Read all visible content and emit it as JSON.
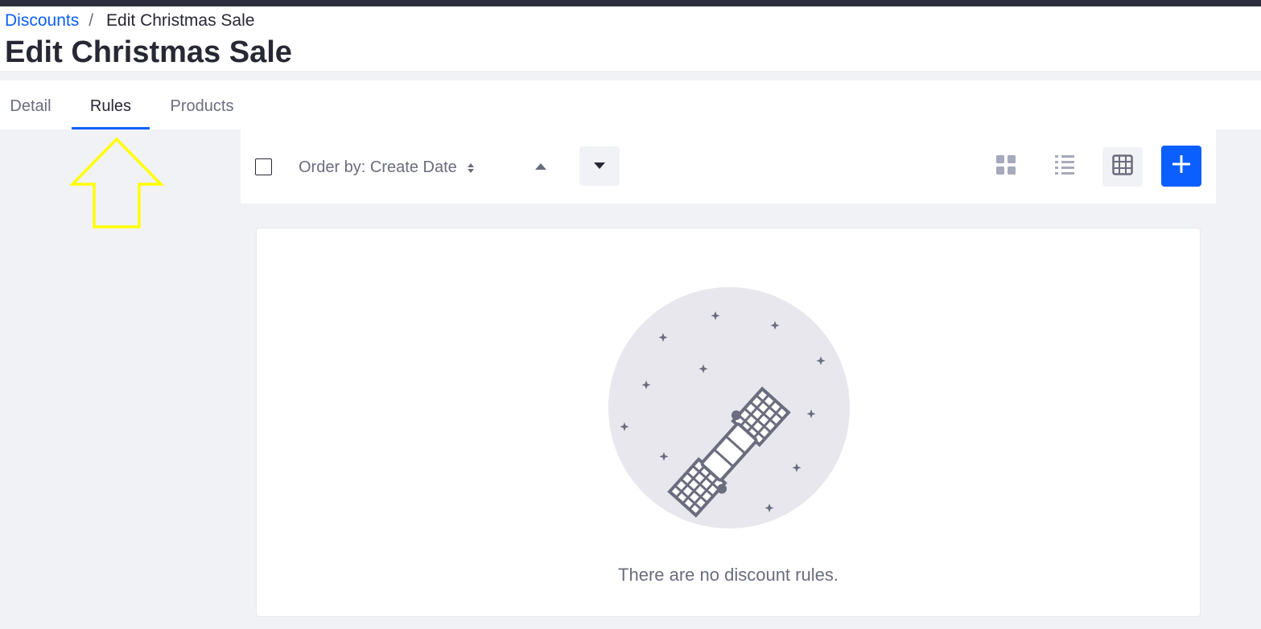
{
  "breadcrumb": {
    "parent": "Discounts",
    "separator": "/",
    "current": "Edit Christmas Sale"
  },
  "page": {
    "title": "Edit Christmas Sale"
  },
  "tabs": [
    {
      "label": "Detail",
      "active": false
    },
    {
      "label": "Rules",
      "active": true
    },
    {
      "label": "Products",
      "active": false
    }
  ],
  "toolbar": {
    "order_by_label": "Order by: Create Date",
    "select_all_checked": false,
    "sort_direction": "descending",
    "active_view": "table"
  },
  "empty_state": {
    "message": "There are no discount rules."
  },
  "colors": {
    "accent": "#0b5fff",
    "annotation_arrow": "#ffff00",
    "topbar": "#2b2d3a",
    "background": "#f1f2f5"
  },
  "icons": {
    "sort": "sort-icon",
    "ascending": "caret-up-icon",
    "descending": "caret-down-icon",
    "cards_view": "cards-view-icon",
    "list_view": "list-view-icon",
    "table_view": "table-view-icon",
    "add": "plus-icon",
    "empty_illustration": "satellite-illustration"
  }
}
